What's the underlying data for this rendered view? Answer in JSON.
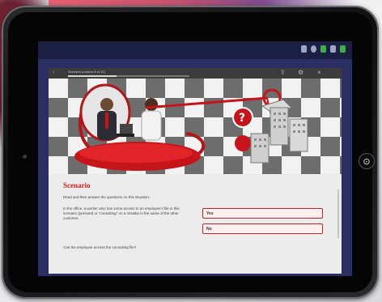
{
  "window": {
    "title": "Scenario (Lesson 8 of 12)"
  },
  "content": {
    "heading": "Scenario",
    "intro": "Read and then answer the questions on this situation:",
    "question1": "In the office, a worker who has some access to an employee's file in this scenario (pressed) or \"consulting\" on a mistake in the name of the other customer.",
    "question2": "Can the employee access the consulting file?"
  },
  "answers": [
    {
      "label": "Yes"
    },
    {
      "label": "No"
    }
  ],
  "titlebar": {
    "progress": 0.4
  },
  "colors": {
    "accent": "#cc1f1f",
    "screen_bg": "#2a2e62",
    "titlebar": "#3b3b3b"
  },
  "icons": {
    "home": "home-button-icon",
    "share": "share-icon",
    "settings": "gear-icon",
    "close": "close-icon",
    "help": "question-mark-icon"
  }
}
